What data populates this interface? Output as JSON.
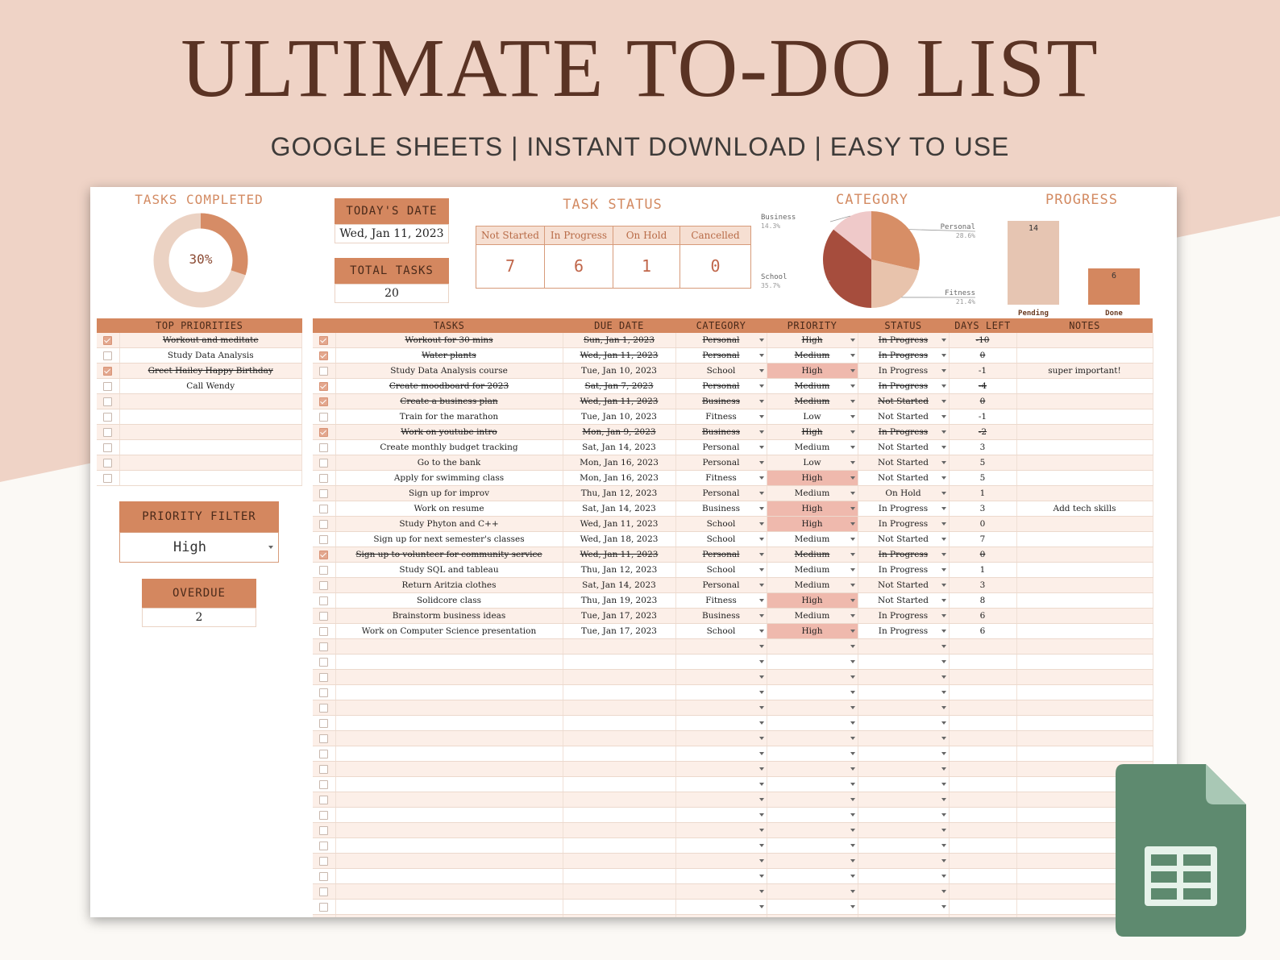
{
  "banner": {
    "title": "ULTIMATE TO-DO LIST",
    "subtitle": "GOOGLE SHEETS | INSTANT DOWNLOAD | EASY TO USE"
  },
  "dashboard": {
    "tasks_completed_label": "TASKS COMPLETED",
    "tasks_completed_pct": "30%",
    "tasks_completed_fraction": 0.3,
    "todays_date_label": "TODAY'S DATE",
    "todays_date": "Wed, Jan 11, 2023",
    "total_tasks_label": "TOTAL TASKS",
    "total_tasks": "20",
    "task_status_label": "TASK STATUS",
    "status": [
      {
        "label": "Not Started",
        "value": "7"
      },
      {
        "label": "In Progress",
        "value": "6"
      },
      {
        "label": "On Hold",
        "value": "1"
      },
      {
        "label": "Cancelled",
        "value": "0"
      }
    ],
    "category_label": "CATEGORY",
    "progress_label": "PROGRESS"
  },
  "chart_data": [
    {
      "type": "pie",
      "title": "CATEGORY",
      "categories": [
        "Personal",
        "Fitness",
        "School",
        "Business"
      ],
      "values": [
        28.6,
        21.4,
        35.7,
        14.3
      ],
      "value_labels": [
        "28.6%",
        "21.4%",
        "35.7%",
        "14.3%"
      ],
      "colors": [
        "#d78e66",
        "#e8c3ac",
        "#a64d3d",
        "#efc9c9"
      ]
    },
    {
      "type": "bar",
      "title": "PROGRESS",
      "categories": [
        "Pending",
        "Done"
      ],
      "values": [
        14,
        6
      ],
      "colors": [
        "#e6c5b2",
        "#d4875f"
      ]
    }
  ],
  "priorities": {
    "header": "TOP PRIORITIES",
    "rows": [
      {
        "checked": true,
        "text": "Workout and meditate"
      },
      {
        "checked": false,
        "text": "Study Data Analysis"
      },
      {
        "checked": true,
        "text": "Greet Hailey Happy Birthday"
      },
      {
        "checked": false,
        "text": "Call Wendy"
      },
      {
        "checked": false,
        "text": ""
      },
      {
        "checked": false,
        "text": ""
      },
      {
        "checked": false,
        "text": ""
      },
      {
        "checked": false,
        "text": ""
      },
      {
        "checked": false,
        "text": ""
      },
      {
        "checked": false,
        "text": ""
      }
    ]
  },
  "filter": {
    "label": "PRIORITY FILTER",
    "value": "High",
    "overdue_label": "OVERDUE",
    "overdue_value": "2"
  },
  "table": {
    "columns": [
      "",
      "TASKS",
      "DUE DATE",
      "CATEGORY",
      "PRIORITY",
      "STATUS",
      "DAYS LEFT",
      "NOTES"
    ],
    "rows": [
      {
        "done": true,
        "task": "Workout for 30 mins",
        "due": "Sun, Jan 1, 2023",
        "category": "Personal",
        "priority": "High",
        "status": "In Progress",
        "days": "-10",
        "notes": ""
      },
      {
        "done": true,
        "task": "Water plants",
        "due": "Wed, Jan 11, 2023",
        "category": "Personal",
        "priority": "Medium",
        "status": "In Progress",
        "days": "0",
        "notes": ""
      },
      {
        "done": false,
        "task": "Study Data Analysis course",
        "due": "Tue, Jan 10, 2023",
        "category": "School",
        "priority": "High",
        "status": "In Progress",
        "days": "-1",
        "notes": "super important!"
      },
      {
        "done": true,
        "task": "Create moodboard for 2023",
        "due": "Sat, Jan 7, 2023",
        "category": "Personal",
        "priority": "Medium",
        "status": "In Progress",
        "days": "-4",
        "notes": ""
      },
      {
        "done": true,
        "task": "Create a business plan",
        "due": "Wed, Jan 11, 2023",
        "category": "Business",
        "priority": "Medium",
        "status": "Not Started",
        "days": "0",
        "notes": ""
      },
      {
        "done": false,
        "task": "Train for the marathon",
        "due": "Tue, Jan 10, 2023",
        "category": "Fitness",
        "priority": "Low",
        "status": "Not Started",
        "days": "-1",
        "notes": ""
      },
      {
        "done": true,
        "task": "Work on youtube intro",
        "due": "Mon, Jan 9, 2023",
        "category": "Business",
        "priority": "High",
        "status": "In Progress",
        "days": "-2",
        "notes": ""
      },
      {
        "done": false,
        "task": "Create monthly budget tracking",
        "due": "Sat, Jan 14, 2023",
        "category": "Personal",
        "priority": "Medium",
        "status": "Not Started",
        "days": "3",
        "notes": ""
      },
      {
        "done": false,
        "task": "Go to the bank",
        "due": "Mon, Jan 16, 2023",
        "category": "Personal",
        "priority": "Low",
        "status": "Not Started",
        "days": "5",
        "notes": ""
      },
      {
        "done": false,
        "task": "Apply for swimming class",
        "due": "Mon, Jan 16, 2023",
        "category": "Fitness",
        "priority": "High",
        "status": "Not Started",
        "days": "5",
        "notes": ""
      },
      {
        "done": false,
        "task": "Sign up for improv",
        "due": "Thu, Jan 12, 2023",
        "category": "Personal",
        "priority": "Medium",
        "status": "On Hold",
        "days": "1",
        "notes": ""
      },
      {
        "done": false,
        "task": "Work on resume",
        "due": "Sat, Jan 14, 2023",
        "category": "Business",
        "priority": "High",
        "status": "In Progress",
        "days": "3",
        "notes": "Add tech skills"
      },
      {
        "done": false,
        "task": "Study Phyton and C++",
        "due": "Wed, Jan 11, 2023",
        "category": "School",
        "priority": "High",
        "status": "In Progress",
        "days": "0",
        "notes": ""
      },
      {
        "done": false,
        "task": "Sign up for next semester's classes",
        "due": "Wed, Jan 18, 2023",
        "category": "School",
        "priority": "Medium",
        "status": "Not Started",
        "days": "7",
        "notes": ""
      },
      {
        "done": true,
        "task": "Sign up to volunteer for community service",
        "due": "Wed, Jan 11, 2023",
        "category": "Personal",
        "priority": "Medium",
        "status": "In Progress",
        "days": "0",
        "notes": ""
      },
      {
        "done": false,
        "task": "Study SQL and tableau",
        "due": "Thu, Jan 12, 2023",
        "category": "School",
        "priority": "Medium",
        "status": "In Progress",
        "days": "1",
        "notes": ""
      },
      {
        "done": false,
        "task": "Return Aritzia clothes",
        "due": "Sat, Jan 14, 2023",
        "category": "Personal",
        "priority": "Medium",
        "status": "Not Started",
        "days": "3",
        "notes": ""
      },
      {
        "done": false,
        "task": "Solidcore class",
        "due": "Thu, Jan 19, 2023",
        "category": "Fitness",
        "priority": "High",
        "status": "Not Started",
        "days": "8",
        "notes": ""
      },
      {
        "done": false,
        "task": "Brainstorm business ideas",
        "due": "Tue, Jan 17, 2023",
        "category": "Business",
        "priority": "Medium",
        "status": "In Progress",
        "days": "6",
        "notes": ""
      },
      {
        "done": false,
        "task": "Work on Computer Science presentation",
        "due": "Tue, Jan 17, 2023",
        "category": "School",
        "priority": "High",
        "status": "In Progress",
        "days": "6",
        "notes": ""
      }
    ],
    "empty_rows": 19
  },
  "colors": {
    "accent": "#d4875f",
    "title": "#5a3324",
    "highlight": "#efb9ad",
    "banner_bg": "#efd3c6",
    "sheets_green": "#5e8a6f"
  }
}
